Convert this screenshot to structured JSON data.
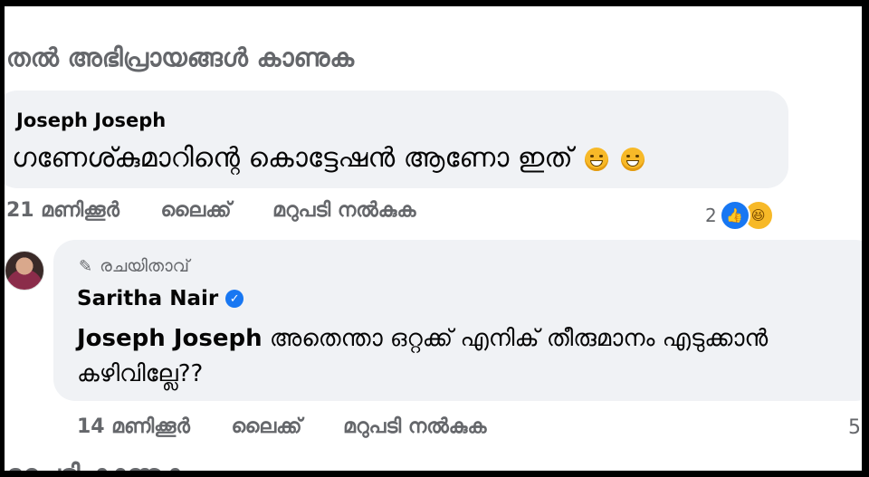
{
  "header": {
    "title": "തൽ അഭിപ്രായങ്ങൾ കാണുക"
  },
  "comment1": {
    "author": "Joseph Joseph",
    "text": "ഗണേശ്കുമാറിന്റെ കൊട്ടേഷൻ ആണോ ഇത്",
    "emojis": [
      "grin-emoji",
      "grin-emoji"
    ],
    "time": "21 മണിക്കൂർ",
    "like_label": "ലൈക്ക്",
    "reply_label": "മറുപടി നൽകുക",
    "reaction_count": "2",
    "reaction_icons": [
      "like-icon",
      "haha-icon"
    ]
  },
  "reply1": {
    "badge": "രചയിതാവ്",
    "author": "Saritha Nair",
    "mention": "Joseph Joseph",
    "text": " അതെന്താ ഒറ്റക്ക് എനിക് തീരുമാനം എടുക്കാൻ കഴിവില്ലേ??",
    "time": "14 മണിക്കൂർ",
    "like_label": "ലൈക്ക്",
    "reply_label": "മറുപടി നൽകുക",
    "reaction_count": "5"
  },
  "footer": {
    "text": "മറുപടി കാണുക"
  },
  "colors": {
    "bubble": "#f0f2f5",
    "secondary_text": "#65676b",
    "brand_blue": "#1877f2"
  }
}
